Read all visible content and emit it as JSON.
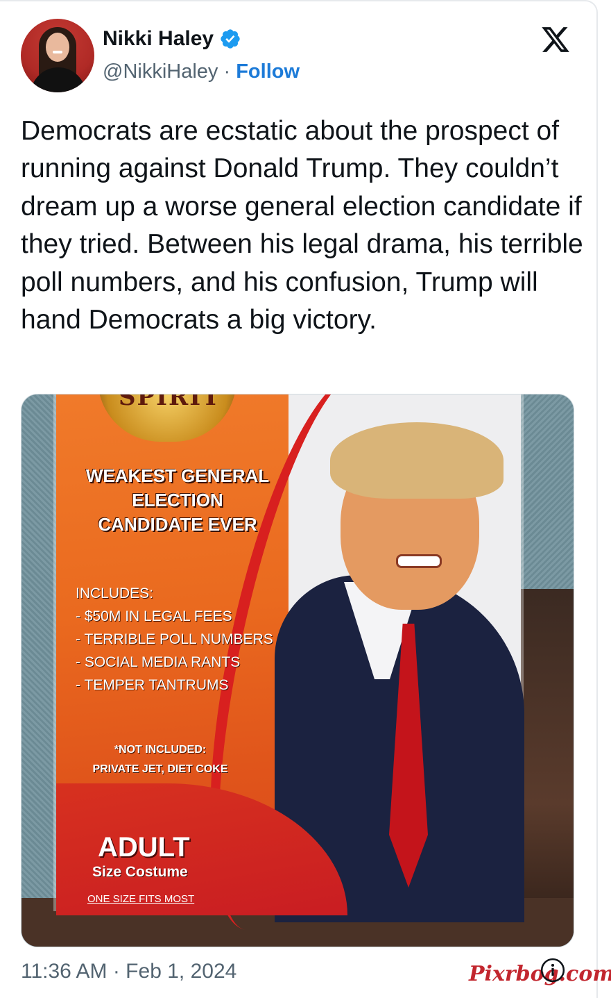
{
  "author": {
    "name": "Nikki Haley",
    "handle": "@NikkiHaley",
    "separator": " · ",
    "follow_label": "Follow",
    "verified": true
  },
  "platform_icon": "x-logo-icon",
  "tweet": {
    "text": "Democrats are ecstatic about the prospect of running against Donald Trump. They couldn’t dream up a worse general election candidate if they tried. Between his legal drama, his terrible poll numbers, and his confusion, Trump will hand Democrats a big victory."
  },
  "image": {
    "brand": "SPIRIT",
    "headline": [
      "WEAKEST GENERAL",
      "ELECTION",
      "CANDIDATE EVER"
    ],
    "includes_label": "INCLUDES:",
    "includes_items": [
      "- $50M IN LEGAL FEES",
      "- TERRIBLE POLL NUMBERS",
      "- SOCIAL MEDIA RANTS",
      "- TEMPER TANTRUMS"
    ],
    "not_included_label": "*NOT INCLUDED:",
    "not_included_items": "PRIVATE JET, DIET COKE",
    "adult": "ADULT",
    "size_costume": "Size Costume",
    "one_size": "ONE SIZE FITS MOST"
  },
  "footer": {
    "timestamp": "11:36 AM · Feb 1, 2024",
    "watermark": "Pixrbog.com"
  },
  "colors": {
    "accent": "#1d7bd8",
    "verified_badge": "#1d9bf0",
    "muted": "#536471"
  }
}
